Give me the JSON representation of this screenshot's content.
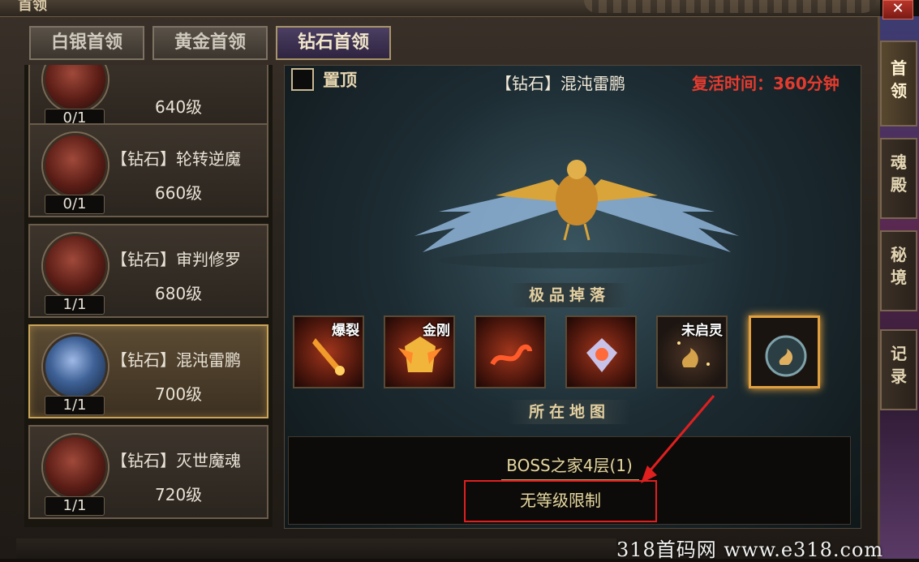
{
  "window": {
    "title": "首领",
    "close_label": "✕"
  },
  "tabs": [
    {
      "label": "白银首领",
      "active": false
    },
    {
      "label": "黄金首领",
      "active": false
    },
    {
      "label": "钻石首领",
      "active": true
    }
  ],
  "boss_list": [
    {
      "name": "",
      "level": "640级",
      "count": "0/1",
      "selected": false
    },
    {
      "name": "【钻石】轮转逆魔",
      "level": "660级",
      "count": "0/1",
      "selected": false
    },
    {
      "name": "【钻石】审判修罗",
      "level": "680级",
      "count": "1/1",
      "selected": false
    },
    {
      "name": "【钻石】混沌雷鹏",
      "level": "700级",
      "count": "1/1",
      "selected": true
    },
    {
      "name": "【钻石】灭世魔魂",
      "level": "720级",
      "count": "1/1",
      "selected": false
    }
  ],
  "detail": {
    "pin_label": "置顶",
    "boss_title": "【钻石】混沌雷鹏",
    "revive_time": "复活时间：360分钟",
    "drops_header": "极品掉落",
    "drops": [
      {
        "tag": "爆裂",
        "icon": "sword-icon"
      },
      {
        "tag": "金刚",
        "icon": "armor-icon"
      },
      {
        "tag": "",
        "icon": "dragon-icon"
      },
      {
        "tag": "",
        "icon": "gem-icon"
      },
      {
        "tag": "未启灵",
        "icon": "spirit-icon"
      },
      {
        "tag": "",
        "icon": "medallion-icon"
      }
    ],
    "map_header": "所在地图",
    "map_name": "BOSS之家4层(1)",
    "level_requirement": "无等级限制"
  },
  "side_tabs": [
    {
      "label": "首领",
      "active": true
    },
    {
      "label": "魂殿",
      "active": false
    },
    {
      "label": "秘境",
      "active": false
    },
    {
      "label": "记录",
      "active": false
    }
  ],
  "watermark": "318首码网  www.e318.com",
  "colors": {
    "revive_red": "#e43b2e",
    "highlight_gold": "#c9a45a",
    "annotation_red": "#e01f1f"
  }
}
